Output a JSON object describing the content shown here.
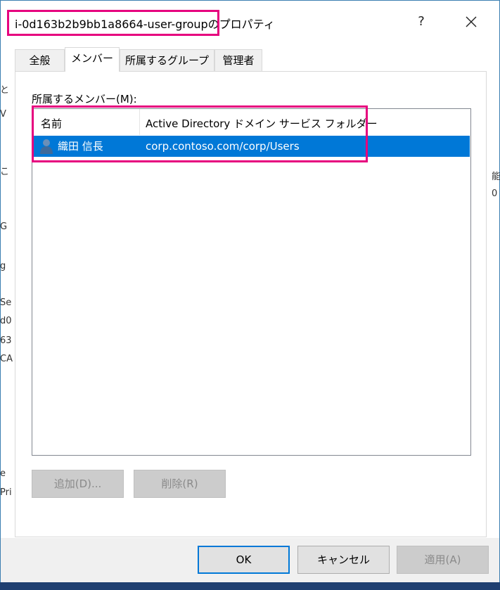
{
  "background": {
    "left_fragments": [
      "と",
      "V",
      "こ",
      "G",
      "g",
      "Se",
      "d0",
      "63",
      "CA",
      "e",
      "Pri"
    ],
    "right_fragments": [
      "能",
      "0"
    ]
  },
  "window": {
    "title": "i-0d163b2b9bb1a8664-user-groupのプロパティ",
    "help_label": "?",
    "close_label": "✕"
  },
  "tabs": [
    {
      "label": "全般",
      "active": false
    },
    {
      "label": "メンバー",
      "active": true
    },
    {
      "label": "所属するグループ",
      "active": false
    },
    {
      "label": "管理者",
      "active": false
    }
  ],
  "members": {
    "label": "所属するメンバー(M):",
    "columns": [
      "名前",
      "Active Directory ドメイン サービス フォルダー"
    ],
    "rows": [
      {
        "name": "織田 信長",
        "folder": "corp.contoso.com/corp/Users",
        "icon": "user-icon",
        "selected": true
      }
    ],
    "add_button": "追加(D)...",
    "remove_button": "削除(R)"
  },
  "footer": {
    "ok": "OK",
    "cancel": "キャンセル",
    "apply": "適用(A)"
  },
  "colors": {
    "selection": "#0078d7",
    "highlight_box": "#e6007e",
    "desktop": "#1f3f70"
  }
}
